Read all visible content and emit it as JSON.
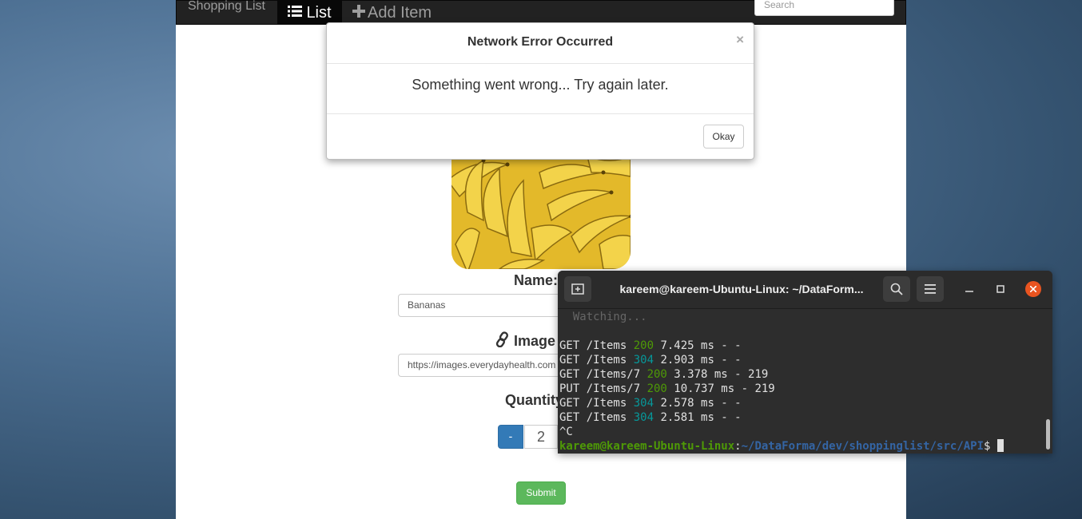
{
  "navbar": {
    "brand": "Shopping List",
    "list_label": "List",
    "add_item_label": "Add Item",
    "search_placeholder": "Search"
  },
  "form": {
    "name_label": "Name:",
    "name_value": "Bananas",
    "image_label": "Image",
    "image_value": "https://images.everydayhealth.com",
    "quantity_label": "Quantity",
    "quantity_minus": "-",
    "quantity_value": "2",
    "submit_label": "Submit"
  },
  "modal": {
    "title": "Network Error Occurred",
    "close_glyph": "×",
    "message": "Something went wrong... Try again later.",
    "okay_label": "Okay"
  },
  "terminal": {
    "title": "kareem@kareem-Ubuntu-Linux: ~/DataForm...",
    "lines": [
      {
        "text": "  Watching..."
      },
      {
        "method_path": "GET /Items ",
        "status": "200",
        "rest": " 7.425 ms - -"
      },
      {
        "method_path": "GET /Items ",
        "status": "304",
        "rest": " 2.903 ms - -"
      },
      {
        "method_path": "GET /Items/7 ",
        "status": "200",
        "rest": " 3.378 ms - 219"
      },
      {
        "method_path": "PUT /Items/7 ",
        "status": "200",
        "rest": " 10.737 ms - 219"
      },
      {
        "method_path": "GET /Items ",
        "status": "304",
        "rest": " 2.578 ms - -"
      },
      {
        "method_path": "GET /Items ",
        "status": "304",
        "rest": " 2.581 ms - -"
      },
      {
        "text": "^C"
      }
    ],
    "prompt_user": "kareem@kareem-Ubuntu-Linux",
    "prompt_sep": ":",
    "prompt_path": "~/DataForma/dev/shoppinglist/src/API",
    "prompt_symbol": "$ "
  },
  "colors": {
    "status_200": "#4e9a06",
    "status_304": "#06989a",
    "terminal_close": "#e95420",
    "submit": "#5cb85c",
    "primary": "#337ab7"
  }
}
